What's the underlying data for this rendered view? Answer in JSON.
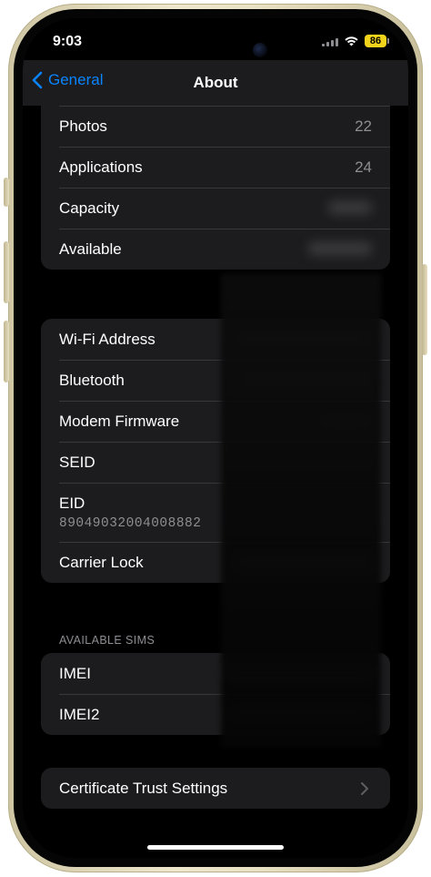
{
  "status_bar": {
    "time": "9:03",
    "battery": "86"
  },
  "nav": {
    "back_label": "General",
    "title": "About"
  },
  "storage_group": {
    "rows": [
      {
        "label": "Photos",
        "value": "22"
      },
      {
        "label": "Applications",
        "value": "24"
      },
      {
        "label": "Capacity",
        "value": ""
      },
      {
        "label": "Available",
        "value": ""
      }
    ]
  },
  "network_group": {
    "rows": [
      {
        "label": "Wi-Fi Address",
        "value": ""
      },
      {
        "label": "Bluetooth",
        "value": ""
      },
      {
        "label": "Modem Firmware",
        "value": ""
      },
      {
        "label": "SEID",
        "value": ""
      },
      {
        "label": "EID",
        "value": "89049032004008882"
      },
      {
        "label": "Carrier Lock",
        "value": ""
      }
    ]
  },
  "sims": {
    "header": "AVAILABLE SIMS",
    "rows": [
      {
        "label": "IMEI",
        "value": ""
      },
      {
        "label": "IMEI2",
        "value": ""
      }
    ]
  },
  "certificate": {
    "label": "Certificate Trust Settings"
  },
  "colors": {
    "accent": "#0a84ff",
    "battery": "#f1d31b",
    "cell_bg": "#1c1c1e",
    "background": "#000000"
  }
}
